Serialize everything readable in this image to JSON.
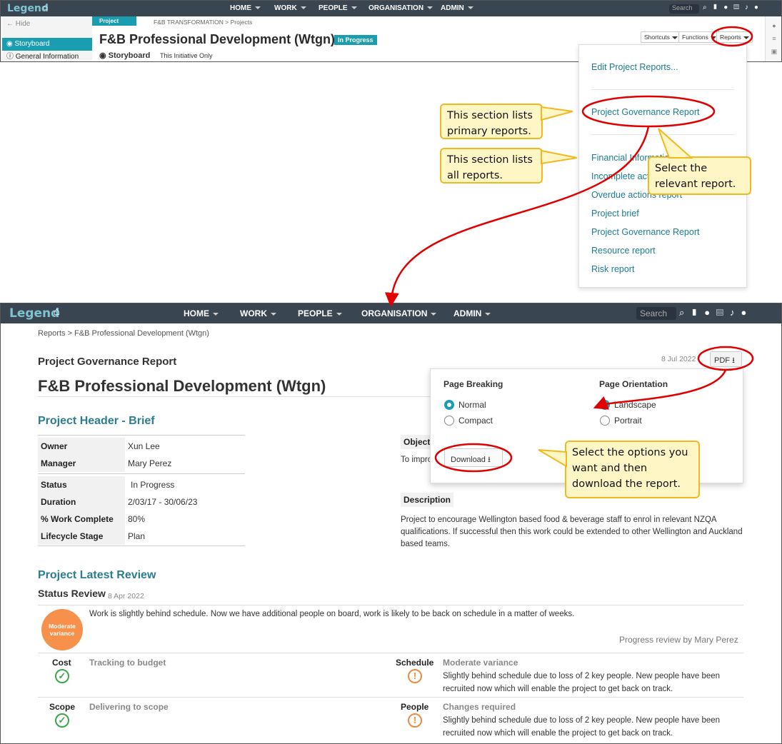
{
  "app": {
    "logo": "Legend"
  },
  "nav": {
    "home": "HOME",
    "work": "WORK",
    "people": "PEOPLE",
    "organisation": "ORGANISATION",
    "admin": "ADMIN",
    "search_placeholder": "Search"
  },
  "top": {
    "hide": "Hide",
    "sidebar": [
      {
        "label": "Storyboard"
      },
      {
        "label": "General Information"
      }
    ],
    "project_tag": "Project",
    "breadcrumb": "F&B TRANSFORMATION > Projects",
    "title": "F&B Professional Development (Wtgn)",
    "status_badge": "In Progress",
    "subtitle": "Storyboard",
    "subtitle_scope": "This Initiative Only",
    "buttons": {
      "shortcuts": "Shortcuts",
      "functions": "Functions",
      "reports": "Reports"
    }
  },
  "reports_menu": {
    "edit": "Edit Project Reports...",
    "primary": [
      "Project Governance Report"
    ],
    "all": [
      "Financial Information",
      "Incomplete actions",
      "Overdue actions report",
      "Project brief",
      "Project Governance Report",
      "Resource report",
      "Risk report"
    ]
  },
  "callouts": {
    "primary": "This section lists primary reports.",
    "all": "This section lists all reports.",
    "select": "Select the relevant report.",
    "download": "Select the options you want and then download the report."
  },
  "report": {
    "breadcrumb": "Reports > F&B Professional Development (Wtgn)",
    "type": "Project Governance Report",
    "date": "8 Jul 2022",
    "pdf_label": "PDF",
    "title": "F&B Professional Development (Wtgn)",
    "header_section": "Project Header - Brief",
    "owner_key": "Owner",
    "owner": "Xun Lee",
    "manager_key": "Manager",
    "manager": "Mary Perez",
    "status_key": "Status",
    "status": "In Progress",
    "duration_key": "Duration",
    "duration": "2/03/17 - 30/06/23",
    "work_key": "% Work Complete",
    "work": "80%",
    "lifecycle_key": "Lifecycle Stage",
    "lifecycle": "Plan",
    "objective_label": "Object",
    "objective_text": "To impro",
    "description_label": "Description",
    "description": "Project to encourage Wellington based food & beverage staff to enrol in relevant NZQA qualifications. If successful then this work could be extended to other Wellington and Auckland based teams.",
    "review_section": "Project Latest Review",
    "status_review": "Status Review",
    "review_date": "8 Apr 2022",
    "variance": "Moderate variance",
    "review_text": "Work is slightly behind schedule. Now we have additional people on board, work is likely to be back on schedule in a matter of weeks.",
    "reviewer": "Progress review by Mary Perez",
    "cost_label": "Cost",
    "cost_status": "Tracking to budget",
    "schedule_label": "Schedule",
    "schedule_status": "Moderate variance",
    "schedule_detail": "Slightly behind schedule due to loss of 2 key people.  New people have been recruited now which will enable the project to get back on track.",
    "scope_label": "Scope",
    "scope_status": "Delivering to scope",
    "people_label": "People",
    "people_status": "Changes required",
    "people_detail": "Slightly behind schedule due to loss of 2 key people.  New people have been recruited now which will enable the project to get back on track."
  },
  "pdf_options": {
    "breaking_title": "Page Breaking",
    "breaking_options": [
      "Normal",
      "Compact"
    ],
    "breaking_selected": "Normal",
    "orientation_title": "Page Orientation",
    "orientation_options": [
      "Landscape",
      "Portrait"
    ],
    "orientation_selected": "Landscape",
    "download": "Download"
  },
  "colors": {
    "navbar": "#3a4552",
    "accent": "#1a9db0",
    "link": "#1b7c91",
    "highlight": "#e00000",
    "callout_bg": "#fff6c5",
    "callout_border": "#f2b820",
    "variance": "#f7904a"
  }
}
